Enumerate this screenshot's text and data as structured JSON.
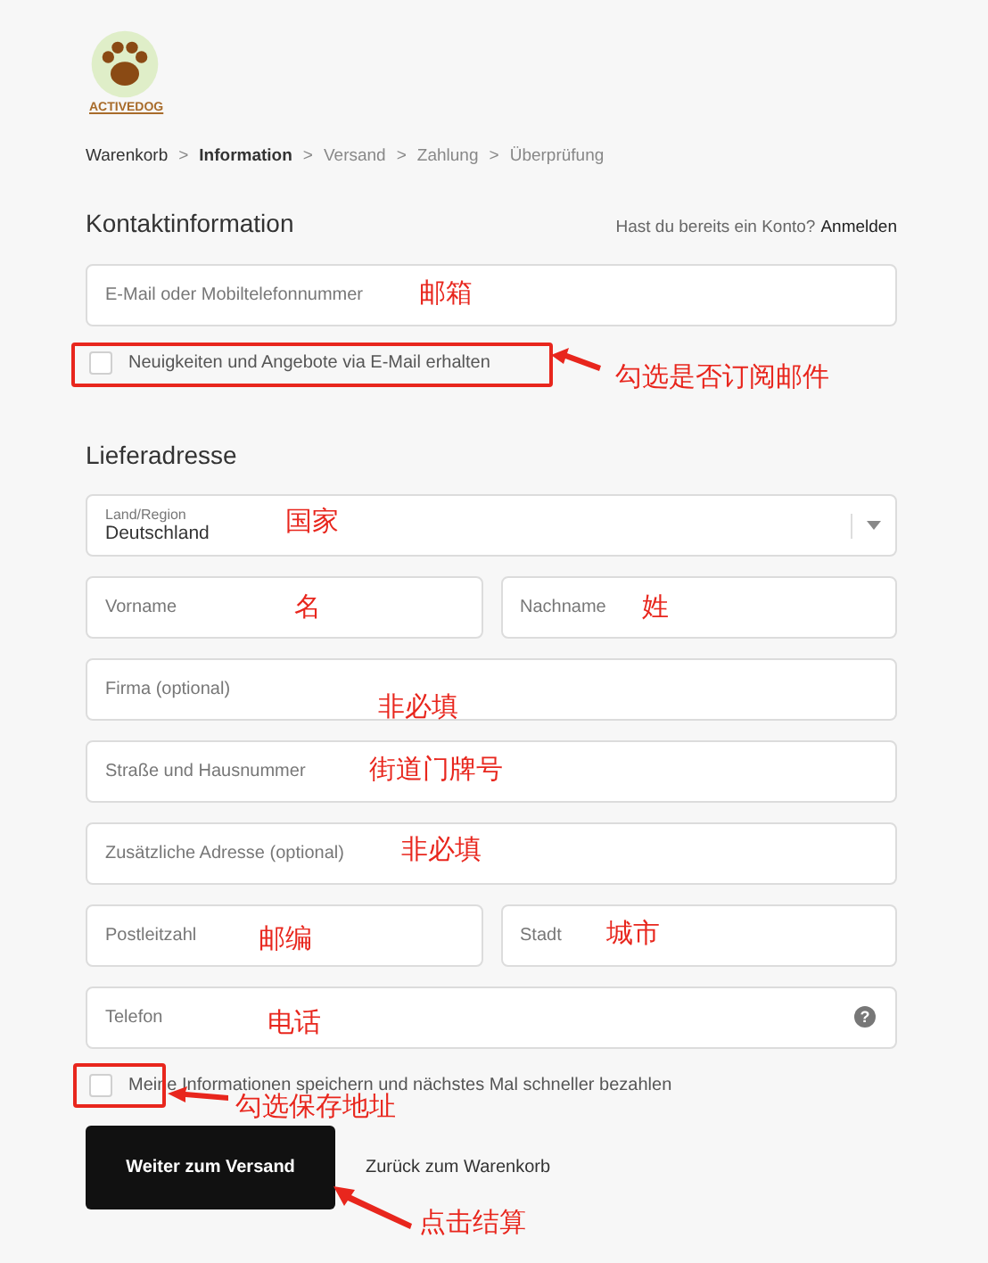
{
  "logo": {
    "text": "ACTIVEDOG"
  },
  "breadcrumb": [
    {
      "label": "Warenkorb",
      "selected": false,
      "link": true
    },
    {
      "label": "Information",
      "selected": true,
      "link": false
    },
    {
      "label": "Versand",
      "selected": false,
      "link": false
    },
    {
      "label": "Zahlung",
      "selected": false,
      "link": false
    },
    {
      "label": "Überprüfung",
      "selected": false,
      "link": false
    }
  ],
  "breadcrumb_separator": ">",
  "contact": {
    "title": "Kontaktinformation",
    "login_prompt": "Hast du bereits ein Konto?",
    "login_link": "Anmelden",
    "email_placeholder": "E-Mail oder Mobiltelefonnummer",
    "newsletter": {
      "label": "Neuigkeiten und Angebote via E-Mail erhalten",
      "checked": false
    }
  },
  "shipping": {
    "title": "Lieferadresse",
    "rows": [
      [
        {
          "kind": "select",
          "label": "Land/Region",
          "value": "Deutschland"
        }
      ],
      [
        {
          "kind": "text",
          "placeholder": "Vorname"
        },
        {
          "kind": "text",
          "placeholder": "Nachname"
        }
      ],
      [
        {
          "kind": "text",
          "placeholder": "Firma (optional)"
        }
      ],
      [
        {
          "kind": "text",
          "placeholder": "Straße und Hausnummer"
        }
      ],
      [
        {
          "kind": "text",
          "placeholder": "Zusätzliche Adresse (optional)"
        }
      ],
      [
        {
          "kind": "text",
          "placeholder": "Postleitzahl"
        },
        {
          "kind": "text",
          "placeholder": "Stadt"
        }
      ],
      [
        {
          "kind": "text",
          "placeholder": "Telefon",
          "help": "?"
        }
      ]
    ],
    "save_info": {
      "label": "Meine Informationen speichern und nächstes Mal schneller bezahlen",
      "checked": false
    }
  },
  "actions": {
    "continue": "Weiter zum Versand",
    "back": "Zurück zum Warenkorb"
  },
  "annotations": [
    {
      "text": "邮箱"
    },
    {
      "text": "勾选是否订阅邮件"
    },
    {
      "text": "国家"
    },
    {
      "text": "名"
    },
    {
      "text": "姓"
    },
    {
      "text": "非必填"
    },
    {
      "text": "街道门牌号"
    },
    {
      "text": "非必填"
    },
    {
      "text": "邮编"
    },
    {
      "text": "城市"
    },
    {
      "text": "电话"
    },
    {
      "text": "勾选保存地址"
    },
    {
      "text": "点击结算"
    }
  ]
}
